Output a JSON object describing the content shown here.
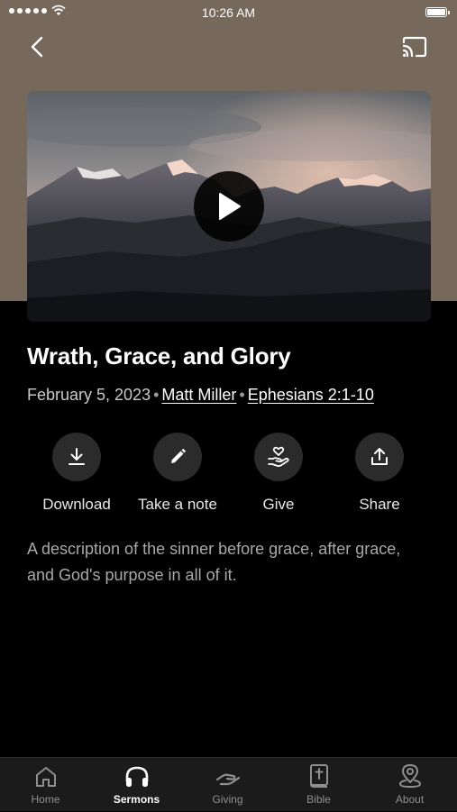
{
  "status_bar": {
    "time": "10:26 AM"
  },
  "sermon": {
    "title": "Wrath, Grace, and Glory",
    "date": "February 5, 2023",
    "speaker": "Matt Miller",
    "scripture": "Ephesians 2:1-10",
    "description": "A description of the sinner before grace, after grace, and God's purpose in all of it."
  },
  "actions": [
    {
      "label": "Download",
      "icon": "download-icon"
    },
    {
      "label": "Take a note",
      "icon": "pencil-icon"
    },
    {
      "label": "Give",
      "icon": "hand-heart-icon"
    },
    {
      "label": "Share",
      "icon": "share-icon"
    }
  ],
  "tabs": [
    {
      "label": "Home",
      "icon": "home-icon",
      "active": false
    },
    {
      "label": "Sermons",
      "icon": "headphones-icon",
      "active": true
    },
    {
      "label": "Giving",
      "icon": "giving-hand-icon",
      "active": false
    },
    {
      "label": "Bible",
      "icon": "bible-icon",
      "active": false
    },
    {
      "label": "About",
      "icon": "location-pin-icon",
      "active": false
    }
  ],
  "colors": {
    "header_band": "#76695b",
    "background": "#000000",
    "tab_bar": "#1b1b1b",
    "action_circle": "#2b2b2b"
  }
}
